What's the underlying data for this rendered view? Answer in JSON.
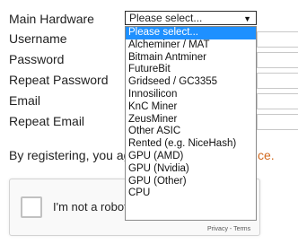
{
  "form": {
    "labels": {
      "main_hardware": "Main Hardware",
      "username": "Username",
      "password": "Password",
      "repeat_password": "Repeat Password",
      "email": "Email",
      "repeat_email": "Repeat Email"
    },
    "hardware_select": {
      "selected": "Please select...",
      "arrow_icon": "caret-down-icon",
      "options": [
        "Please select...",
        "Alcheminer / MAT",
        "Bitmain Antminer",
        "FutureBit",
        "Gridseed / GC3355",
        "Innosilicon",
        "KnC Miner",
        "ZeusMiner",
        "Other ASIC",
        "Rented (e.g. NiceHash)",
        "GPU (AMD)",
        "GPU (Nvidia)",
        "GPU (Other)",
        "CPU"
      ]
    },
    "terms": {
      "text": "By registering, you ag",
      "link_fragment": "ce."
    }
  },
  "recaptcha": {
    "label": "I'm not a robot",
    "privacy": "Privacy",
    "separator": "-",
    "terms": "Terms"
  },
  "colors": {
    "selected_option": "#1e90ff",
    "link": "#d2691e"
  }
}
